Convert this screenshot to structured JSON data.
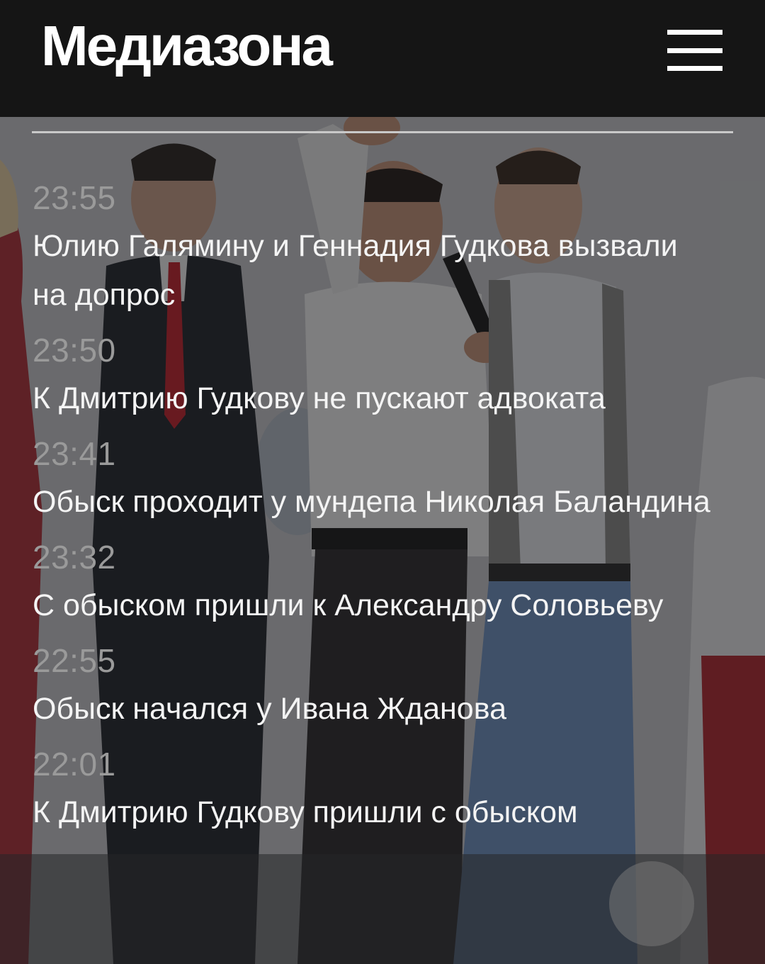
{
  "header": {
    "logo": "Медиазона",
    "menu_icon": "hamburger-menu-icon"
  },
  "news": [
    {
      "time": "23:55",
      "title": "Юлию Галямину и Геннадия Гудкова вызвали на допрос"
    },
    {
      "time": "23:50",
      "title": "К Дмитрию Гудкову не пускают адвоката"
    },
    {
      "time": "23:41",
      "title": "Обыск проходит у мундепа Николая Баландина"
    },
    {
      "time": "23:32",
      "title": "С обыском пришли к Александру Соловьеву"
    },
    {
      "time": "22:55",
      "title": "Обыск начался у Ивана Жданова"
    },
    {
      "time": "22:01",
      "title": "К Дмитрию Гудкову пришли с обыском"
    }
  ],
  "colors": {
    "header_bg": "#151515",
    "headline_text": "#f4f4f4",
    "time_text": "#9a9a9a",
    "divider": "#c9c9c9"
  }
}
